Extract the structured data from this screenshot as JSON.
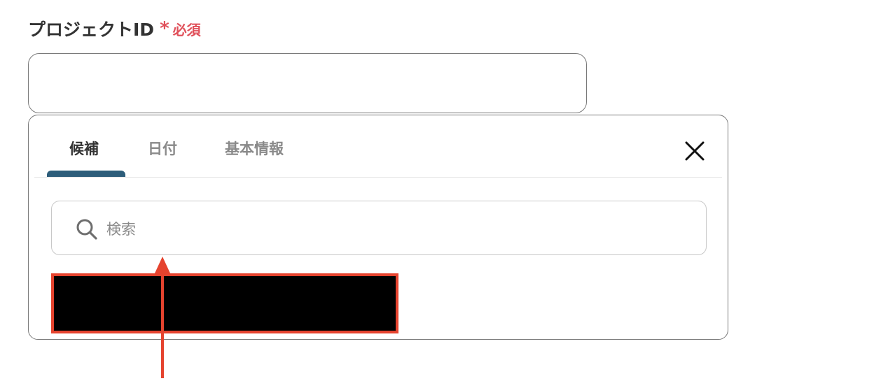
{
  "field": {
    "label": "プロジェクトID",
    "asterisk": "*",
    "required": "必須",
    "value": ""
  },
  "dropdown": {
    "tabs": [
      {
        "label": "候補",
        "active": true
      },
      {
        "label": "日付",
        "active": false
      },
      {
        "label": "基本情報",
        "active": false
      }
    ],
    "search": {
      "placeholder": "検索"
    },
    "options": [
      {
        "label": "",
        "redacted": true,
        "highlighted": true
      }
    ]
  },
  "colors": {
    "accent": "#2d5d7a",
    "required": "#e0505a",
    "annotation": "#e5432e"
  },
  "icons": {
    "close": "close-icon",
    "search": "search-icon",
    "annotation": "arrow-up-icon"
  }
}
